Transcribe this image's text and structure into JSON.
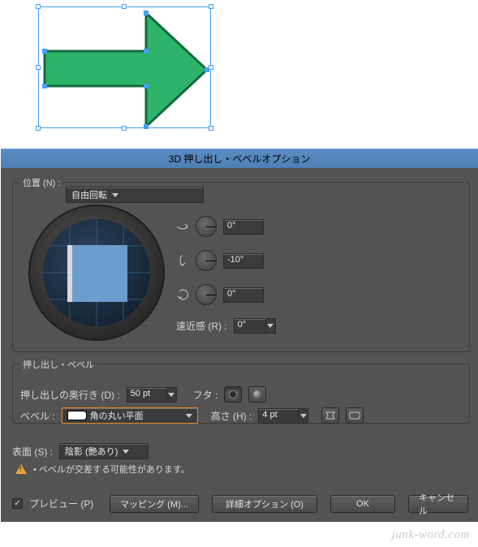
{
  "dialog": {
    "title": "3D 押し出し・ベベルオプション",
    "position": {
      "label": "位置 (N) :",
      "value": "自由回転"
    },
    "rotation": {
      "x": "0°",
      "y": "-10°",
      "z": "0°",
      "perspective_label": "遠近感 (R) :",
      "perspective": "0°"
    },
    "extrude": {
      "group_label": "押し出し・ベベル",
      "depth_label": "押し出しの奥行き (D) :",
      "depth": "50 pt",
      "cap_label": "フタ :",
      "bevel_label": "ベベル :",
      "bevel_value": "角の丸い平面",
      "height_label": "高さ (H) :",
      "height": "4 pt"
    },
    "surface": {
      "label": "表面 (S) :",
      "value": "陰影 (艶あり)",
      "warning": "• ベベルが交差する可能性があります。"
    },
    "preview_label": "プレビュー (P)",
    "buttons": {
      "mapping": "マッピング (M)...",
      "more": "詳細オプション (O)",
      "ok": "OK",
      "cancel": "キャンセル"
    }
  },
  "watermark": "junk-word.com",
  "shape": {
    "type": "arrow-right",
    "fill": "#2fb269",
    "stroke": "#116b3e"
  }
}
